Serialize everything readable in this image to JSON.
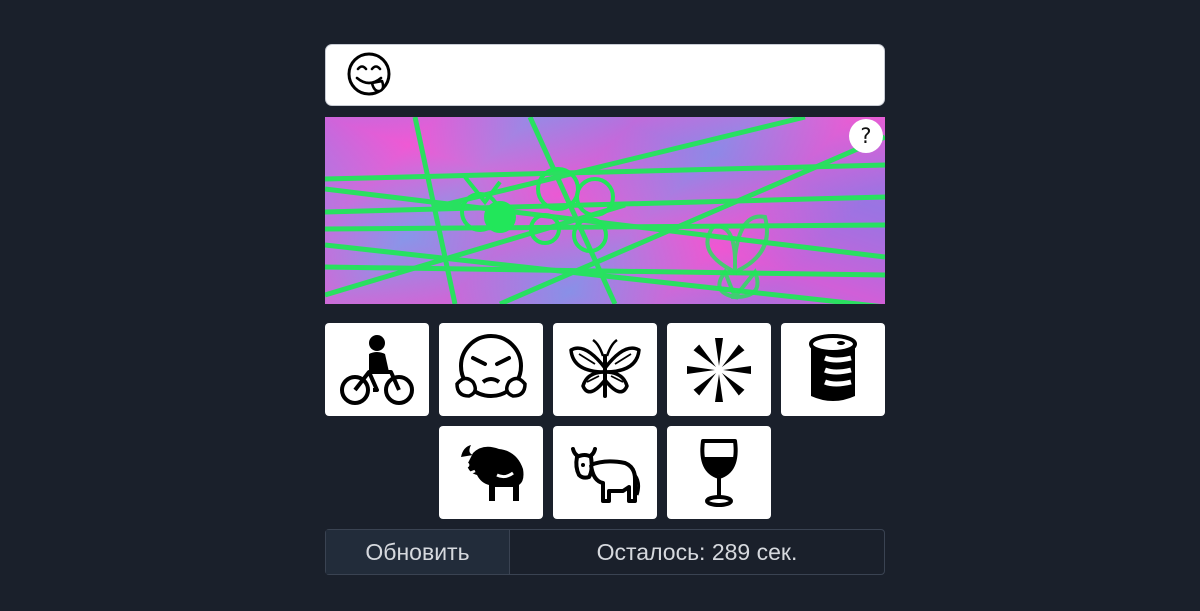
{
  "captcha": {
    "prompt_icon": "face-savoring-food-icon",
    "help_label": "?",
    "challenge_icons": [
      "bicycle-rider-icon",
      "ribbon-icon",
      "butterfly-icon"
    ],
    "line_color": "#1ee85a",
    "choices": [
      {
        "icon": "person-biking-icon"
      },
      {
        "icon": "face-with-steam-icon"
      },
      {
        "icon": "butterfly-icon"
      },
      {
        "icon": "eight-spoked-asterisk-icon"
      },
      {
        "icon": "oil-drum-icon"
      },
      {
        "icon": "bison-icon"
      },
      {
        "icon": "ox-icon"
      },
      {
        "icon": "wine-glass-icon"
      }
    ],
    "refresh_label": "Обновить",
    "timer_label": "Осталось: 289 сек."
  }
}
